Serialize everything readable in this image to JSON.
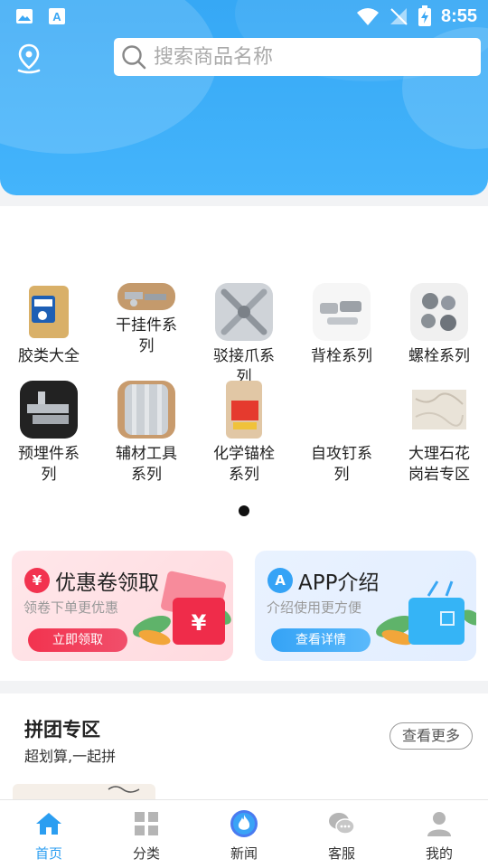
{
  "status_bar": {
    "time": "8:55"
  },
  "search": {
    "placeholder": "搜索商品名称"
  },
  "categories": [
    {
      "label": "胶类大全"
    },
    {
      "label": "干挂件系列"
    },
    {
      "label": "驳接爪系列"
    },
    {
      "label": "背栓系列"
    },
    {
      "label": "螺栓系列"
    },
    {
      "label": "预埋件系列"
    },
    {
      "label": "辅材工具系列"
    },
    {
      "label": "化学锚栓系列"
    },
    {
      "label": "自攻钉系列"
    },
    {
      "label": "大理石花岗岩专区"
    }
  ],
  "promo": {
    "coupon": {
      "title": "优惠卷领取",
      "subtitle": "领卷下单更优惠",
      "button": "立即领取",
      "icon": "yen-coin-icon",
      "color": "#f2334f"
    },
    "app": {
      "title": "APP介绍",
      "subtitle": "介绍使用更方便",
      "button": "查看详情",
      "icon": "app-a-icon",
      "color": "#35a3f6"
    }
  },
  "group_buy": {
    "title": "拼团专区",
    "subtitle": "超划算,一起拼",
    "more": "查看更多"
  },
  "tabs": [
    {
      "label": "首页",
      "icon": "home-icon",
      "active": true
    },
    {
      "label": "分类",
      "icon": "grid-icon",
      "active": false
    },
    {
      "label": "新闻",
      "icon": "flame-icon",
      "active": false
    },
    {
      "label": "客服",
      "icon": "chat-icon",
      "active": false
    },
    {
      "label": "我的",
      "icon": "user-icon",
      "active": false
    }
  ],
  "colors": {
    "primary": "#3aaaf7",
    "active_tab": "#2b9ef1",
    "coupon_red": "#f2334f"
  }
}
